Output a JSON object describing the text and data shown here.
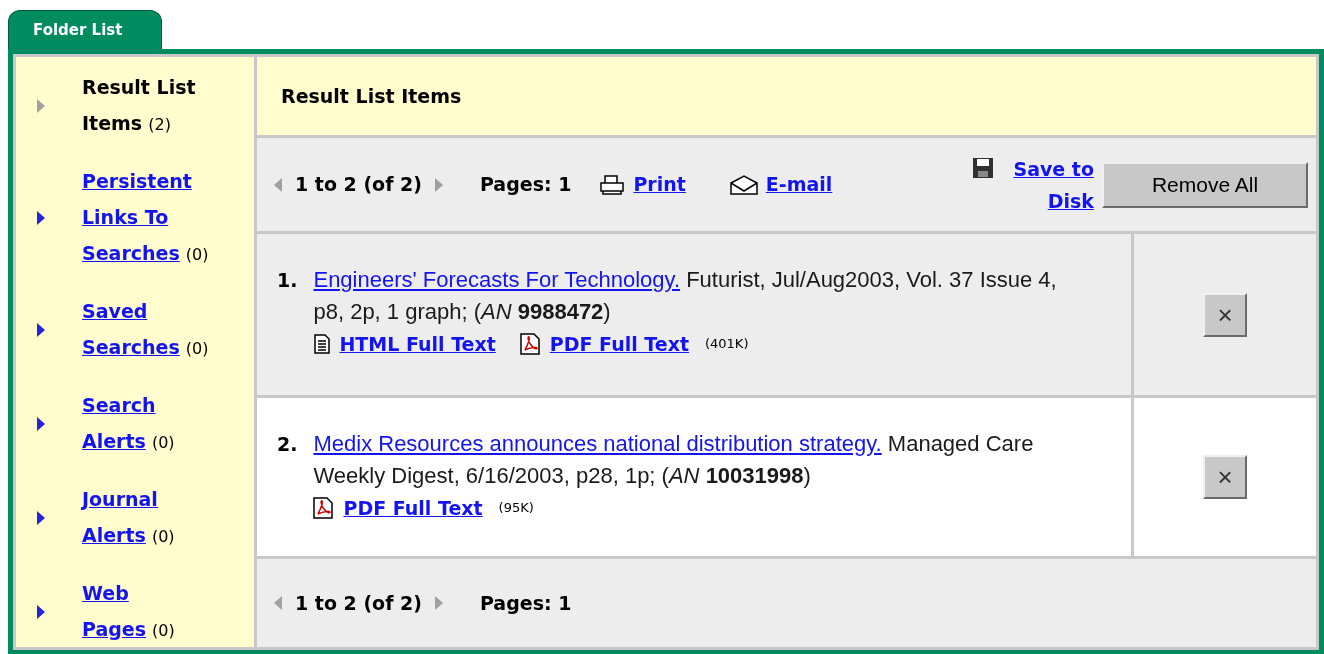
{
  "tab": {
    "label": "Folder List"
  },
  "sidebar": {
    "items": [
      {
        "label": "Result List Items",
        "count": "(2)",
        "selected": true
      },
      {
        "label": "Persistent Links To Searches",
        "count": "(0)",
        "selected": false
      },
      {
        "label": "Saved Searches",
        "count": "(0)",
        "selected": false
      },
      {
        "label": "Search Alerts",
        "count": "(0)",
        "selected": false
      },
      {
        "label": "Journal Alerts",
        "count": "(0)",
        "selected": false
      },
      {
        "label": "Web Pages",
        "count": "(0)",
        "selected": false
      }
    ]
  },
  "header": {
    "title": "Result List Items"
  },
  "toolbar": {
    "range": "1 to 2 (of 2)",
    "pages": "Pages: 1",
    "print": "Print",
    "email": "E-mail",
    "save": "Save to Disk",
    "remove_all": "Remove All"
  },
  "results": [
    {
      "number": "1.",
      "title": "Engineers' Forecasts For Technology.",
      "details": "Futurist, Jul/Aug2003, Vol. 37 Issue 4, p8, 2p, 1 graph; (*AN* **9988472**)",
      "shaded": true,
      "links": [
        {
          "kind": "html",
          "label": "HTML Full Text"
        },
        {
          "kind": "pdf",
          "label": "PDF Full Text",
          "size": "(401K)"
        }
      ],
      "remove": "×"
    },
    {
      "number": "2.",
      "title": "Medix Resources announces national distribution strategy.",
      "details": "Managed Care Weekly Digest, 6/16/2003, p28, 1p; (*AN* **10031998**)",
      "shaded": false,
      "links": [
        {
          "kind": "pdf",
          "label": "PDF Full Text",
          "size": "(95K)"
        }
      ],
      "remove": "×"
    }
  ],
  "footer": {
    "range": "1 to 2 (of 2)",
    "pages": "Pages: 1"
  }
}
